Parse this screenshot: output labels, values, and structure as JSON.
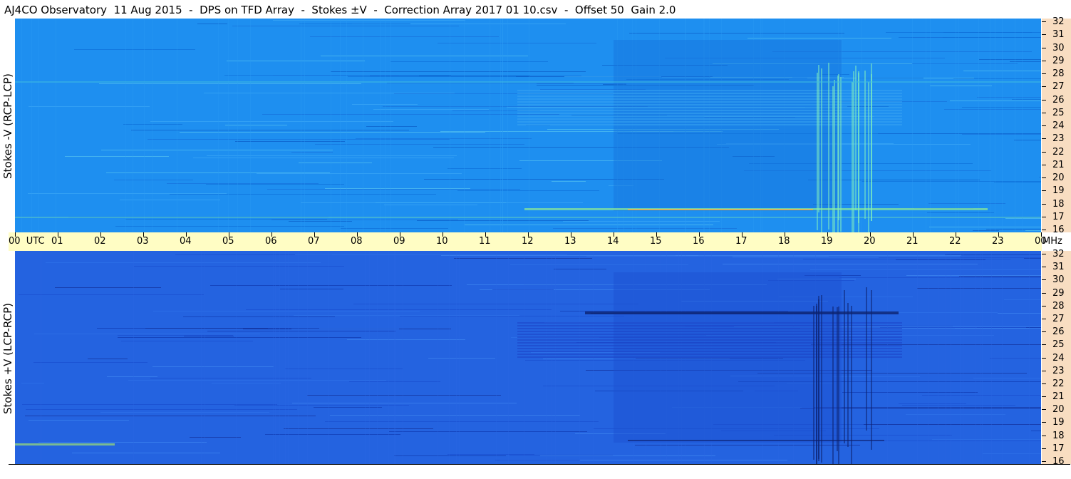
{
  "header": {
    "title": "AJ4CO Observatory  11 Aug 2015  -  DPS on TFD Array  -  Stokes ±V  -  Correction Array 2017 01 10.csv  -  Offset 50  Gain 2.0"
  },
  "panels": {
    "top": {
      "label": "Stokes -V (RCP-LCP)",
      "base_color": "#1e8ff0"
    },
    "bottom": {
      "label": "Stokes +V (LCP-RCP)",
      "base_color": "#2463e0"
    }
  },
  "time_axis": {
    "labels": [
      "00  UTC",
      "01",
      "02",
      "03",
      "04",
      "05",
      "06",
      "07",
      "08",
      "09",
      "10",
      "11",
      "12",
      "13",
      "14",
      "15",
      "16",
      "17",
      "18",
      "19",
      "20",
      "21",
      "22",
      "23",
      "00"
    ],
    "unit": "MHz",
    "background": "#fffdc4"
  },
  "freq_scale": {
    "labels": [
      "32",
      "31",
      "30",
      "29",
      "28",
      "27",
      "26",
      "25",
      "24",
      "23",
      "22",
      "21",
      "20",
      "19",
      "18",
      "17",
      "16"
    ],
    "background": "#f8ddc1"
  }
}
